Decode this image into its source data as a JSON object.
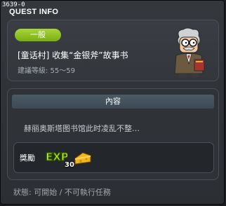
{
  "window": {
    "quest_id": "3639-0",
    "title": "QUEST INFO"
  },
  "quest": {
    "badge": "一般",
    "title": "[童话村] 收集“金银斧”故事书",
    "level": "建議等級: 55～59"
  },
  "content": {
    "header": "內容",
    "description": "赫丽奥斯塔图书馆此时凌乱不整…"
  },
  "reward": {
    "label": "獎勵",
    "exp_text": "EXP",
    "amount": "30"
  },
  "status": {
    "text": "狀態: 可開始 / 不可執行任務"
  },
  "colors": {
    "badge_green": "#8fc323",
    "header_blue": "#44535e",
    "background": "#2e3237"
  }
}
